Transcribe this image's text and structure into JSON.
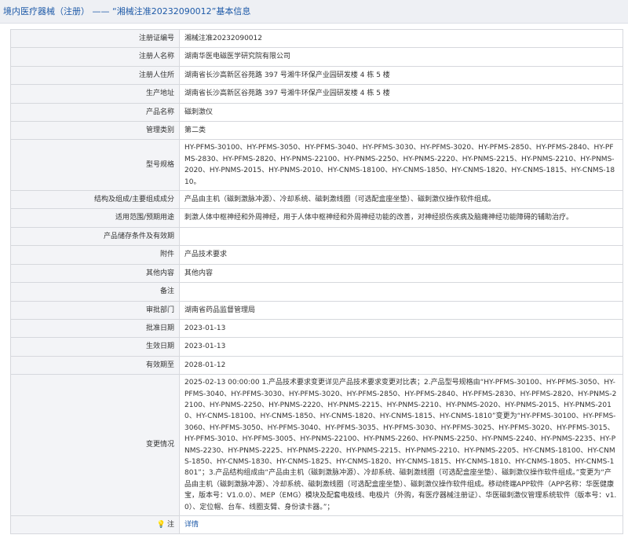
{
  "header": {
    "category": "境内医疗器械（注册）",
    "separator": "——",
    "title": "“湘械注准20232090012”基本信息"
  },
  "rows": [
    {
      "label": "注册证编号",
      "value": "湘械注准20232090012"
    },
    {
      "label": "注册人名称",
      "value": "湖南华医电磁医学研究院有限公司"
    },
    {
      "label": "注册人住所",
      "value": "湖南省长沙高新区谷苑路 397 号湘牛环保产业园研发楼 4 栋 5 楼"
    },
    {
      "label": "生产地址",
      "value": "湖南省长沙高新区谷苑路 397 号湘牛环保产业园研发楼 4 栋 5 楼"
    },
    {
      "label": "产品名称",
      "value": "磁刺激仪"
    },
    {
      "label": "管理类别",
      "value": "第二类"
    },
    {
      "label": "型号规格",
      "value": "HY-PFMS-30100、HY-PFMS-3050、HY-PFMS-3040、HY-PFMS-3030、HY-PFMS-3020、HY-PFMS-2850、HY-PFMS-2840、HY-PFMS-2830、HY-PFMS-2820、HY-PNMS-22100、HY-PNMS-2250、HY-PNMS-2220、HY-PNMS-2215、HY-PNMS-2210、HY-PNMS-2020、HY-PNMS-2015、HY-PNMS-2010、HY-CNMS-18100、HY-CNMS-1850、HY-CNMS-1820、HY-CNMS-1815、HY-CNMS-1810。"
    },
    {
      "label": "结构及组成/主要组成成分",
      "value": "产品由主机（磁刺激脉冲源）、冷却系统、磁刺激线圈（可选配盒座坐垫）、磁刺激仪操作软件组成。"
    },
    {
      "label": "适用范围/预期用途",
      "value": "刺激人体中枢神经和外周神经，用于人体中枢神经和外周神经功能的改善，对神经损伤疾病及脑瘫神经功能障碍的辅助治疗。"
    },
    {
      "label": "产品储存条件及有效期",
      "value": ""
    },
    {
      "label": "附件",
      "value": "产品技术要求"
    },
    {
      "label": "其他内容",
      "value": "其他内容"
    },
    {
      "label": "备注",
      "value": ""
    },
    {
      "label": "审批部门",
      "value": "湖南省药品监督管理局"
    },
    {
      "label": "批准日期",
      "value": "2023-01-13"
    },
    {
      "label": "生效日期",
      "value": "2023-01-13"
    },
    {
      "label": "有效期至",
      "value": "2028-01-12"
    },
    {
      "label": "变更情况",
      "value": "2025-02-13 00:00:00 1.产品技术要求变更详见产品技术要求变更对比表；2.产品型号规格由“HY-PFMS-30100、HY-PFMS-3050、HY-PFMS-3040、HY-PFMS-3030、HY-PFMS-3020、HY-PFMS-2850、HY-PFMS-2840、HY-PFMS-2830、HY-PFMS-2820、HY-PNMS-22100、HY-PNMS-2250、HY-PNMS-2220、HY-PNMS-2215、HY-PNMS-2210、HY-PNMS-2020、HY-PNMS-2015、HY-PNMS-2010、HY-CNMS-18100、HY-CNMS-1850、HY-CNMS-1820、HY-CNMS-1815、HY-CNMS-1810”变更为“HY-PFMS-30100、HY-PFMS-3060、HY-PFMS-3050、HY-PFMS-3040、HY-PFMS-3035、HY-PFMS-3030、HY-PFMS-3025、HY-PFMS-3020、HY-PFMS-3015、HY-PFMS-3010、HY-PFMS-3005、HY-PNMS-22100、HY-PNMS-2260、HY-PNMS-2250、HY-PNMS-2240、HY-PNMS-2235、HY-PNMS-2230、HY-PNMS-2225、HY-PNMS-2220、HY-PNMS-2215、HY-PNMS-2210、HY-PNMS-2205、HY-CNMS-18100、HY-CNMS-1850、HY-CNMS-1830、HY-CNMS-1825、HY-CNMS-1820、HY-CNMS-1815、HY-CNMS-1810、HY-CNMS-1805、HY-CNMS-1801”；3.产品结构组成由“产品由主机（磁刺激脉冲源）、冷却系统、磁刺激线圈（可选配盒座坐垫）、磁刺激仪操作软件组成。”变更为“产品由主机（磁刺激脉冲源）、冷却系统、磁刺激线圈（可选配盒座坐垫）、磁刺激仪操作软件组成。移动终端APP软件（APP名称：华医健康宝，版本号：V1.0.0）、MEP（EMG）模块及配套电极线、电极片（外购，有医疗器械注册证）、华医磁刺激仪管理系统软件（版本号：v1.0）、定位帽、台车、线圈支臂、身份读卡器。”；"
    }
  ],
  "footer": {
    "label": "注",
    "icon": "lightbulb-icon",
    "link_text": "详情"
  },
  "colors": {
    "link": "#1e5aa8",
    "label_bg": "#f3f4f7",
    "border": "#d6d8dd",
    "header_bg": "#eef0f4"
  }
}
